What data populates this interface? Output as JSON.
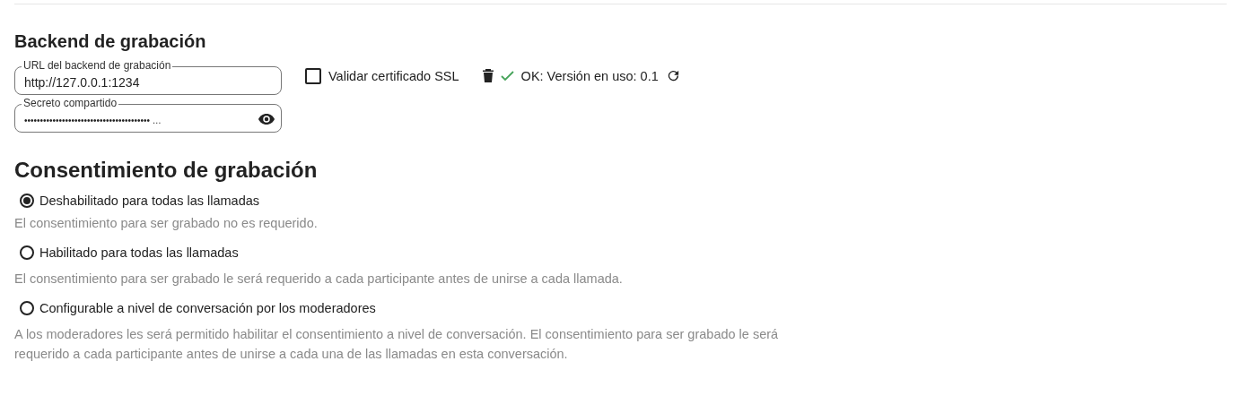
{
  "backend": {
    "title": "Backend de grabación",
    "fields": [
      {
        "kind": "text",
        "label": "URL del backend de grabación",
        "value": "http://127.0.0.1:1234"
      },
      {
        "kind": "password",
        "label": "Secreto compartido",
        "value": "•••••••••••••••••••••••••••••••••••••••• …"
      }
    ],
    "ssl_checkbox": {
      "label": "Validar certificado SSL",
      "checked": false
    },
    "status": {
      "ok": true,
      "text": "OK: Versión en uso: 0.1"
    }
  },
  "consent": {
    "title": "Consentimiento de grabación",
    "options": [
      {
        "label": "Deshabilitado para todas las llamadas",
        "selected": true,
        "description": "El consentimiento para ser grabado no es requerido."
      },
      {
        "label": "Habilitado para todas las llamadas",
        "selected": false,
        "description": "El consentimiento para ser grabado le será requerido a cada participante antes de unirse a cada llamada."
      },
      {
        "label": "Configurable a nivel de conversación por los moderadores",
        "selected": false,
        "description": "A los moderadores les será permitido habilitar el consentimiento a nivel de conversación. El consentimiento para ser grabado le será requerido a cada participante antes de unirse a cada una de las llamadas en esta conversación."
      }
    ]
  }
}
